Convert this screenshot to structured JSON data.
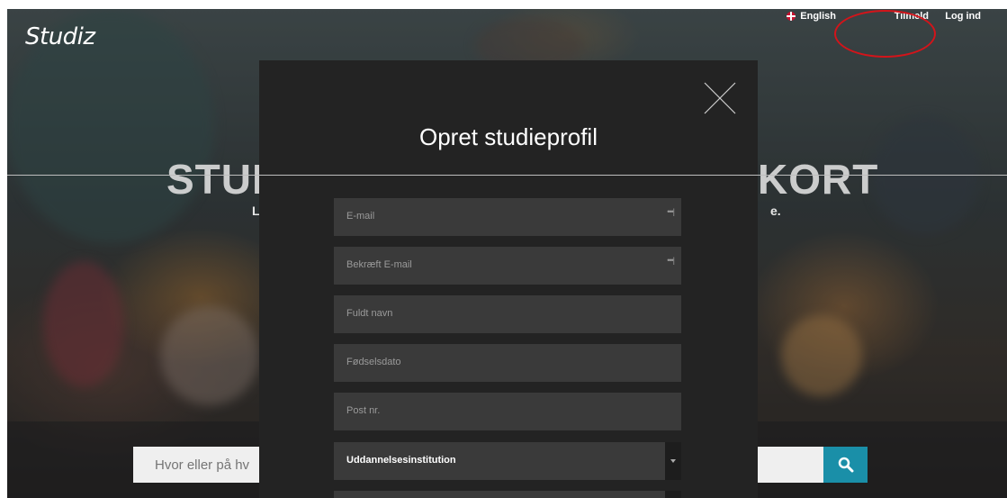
{
  "header": {
    "logo": "Studiz",
    "nav": {
      "language": "English",
      "signup": "Tilmeld",
      "login": "Log ind"
    }
  },
  "hero": {
    "title_left": "STUD",
    "title_right": "KORT",
    "subtitle_left": "Li",
    "subtitle_right": "e."
  },
  "search": {
    "placeholder": "Hvor eller på hv"
  },
  "modal": {
    "title": "Opret studieprofil",
    "fields": [
      {
        "placeholder": "E-mail",
        "has_autofill_icon": true
      },
      {
        "placeholder": "Bekræft E-mail",
        "has_autofill_icon": true
      },
      {
        "placeholder": "Fuldt navn",
        "has_autofill_icon": false
      },
      {
        "placeholder": "Fødselsdato",
        "has_autofill_icon": false
      },
      {
        "placeholder": "Post nr.",
        "has_autofill_icon": false
      }
    ],
    "institution_select": {
      "value": "Uddannelsesinstitution"
    },
    "autofill_icon_glyph": "•••|"
  },
  "icons": {
    "close": "close-icon",
    "search": "search-icon",
    "flag": "uk-flag-icon",
    "dropdown": "chevron-down-icon"
  },
  "colors": {
    "modal_bg": "#232323",
    "field_bg": "#3a3a3a",
    "search_button": "#1a8fa8",
    "annotation_circle": "#d3141a"
  }
}
